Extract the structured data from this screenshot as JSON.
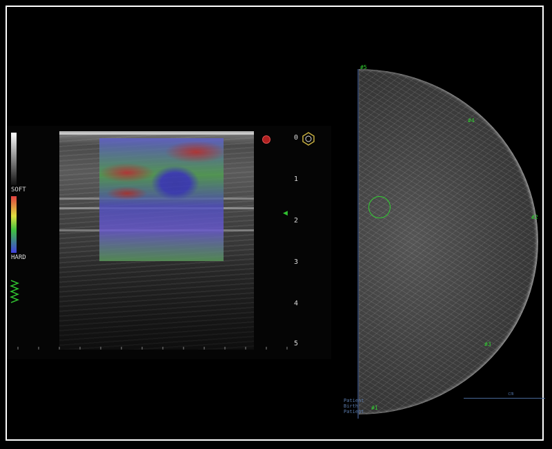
{
  "ultrasound": {
    "scale_soft_label": "SOFT",
    "scale_hard_label": "HARD",
    "depth_labels": [
      "0",
      "1",
      "2",
      "3",
      "4",
      "5"
    ]
  },
  "mammogram": {
    "markers": [
      "#5",
      "#4",
      "#2",
      "#3",
      "#1"
    ],
    "patient_info": [
      "Patient",
      "Birth",
      "Patient"
    ],
    "scale_label": "cm"
  },
  "colors": {
    "frame": "#ffffff",
    "background": "#000000",
    "overlay_green": "#30d030"
  }
}
